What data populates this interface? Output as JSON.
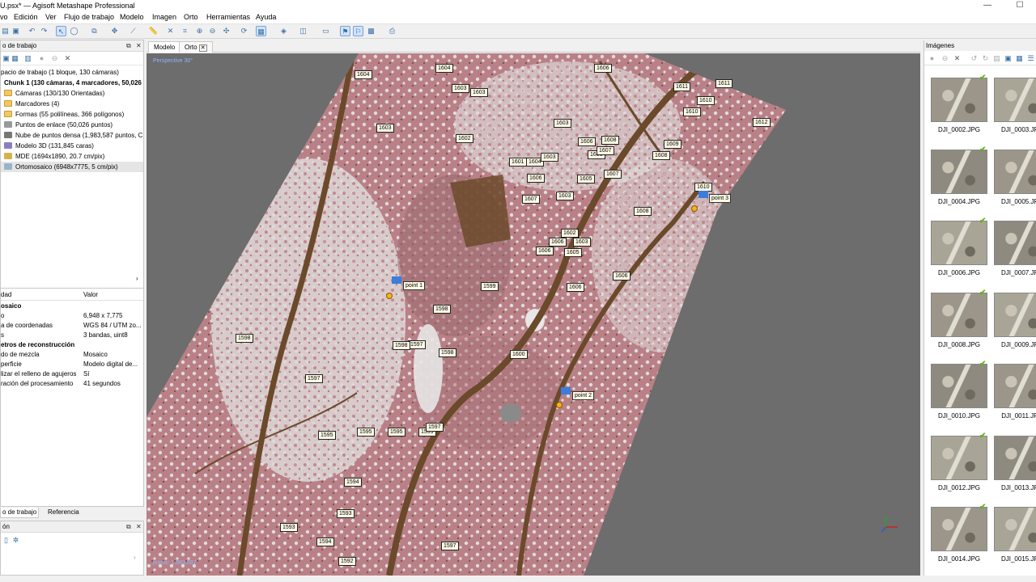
{
  "window": {
    "title": "U.psx* — Agisoft Metashape Professional"
  },
  "menu": [
    "vo",
    "Edición",
    "Ver",
    "Flujo de trabajo",
    "Modelo",
    "Imagen",
    "Orto",
    "Herramientas",
    "Ayuda"
  ],
  "workspace": {
    "header": "o de trabajo",
    "items": [
      "pacio de trabajo (1 bloque, 130 cámaras)",
      "Chunk 1 (130 cámaras, 4 marcadores, 50,026",
      "Cámaras (130/130 Orientadas)",
      "Marcadores (4)",
      "Formas (55 polilíneas, 366 polígonos)",
      "Puntos de enlace (50,026 puntos)",
      "Nube de puntos densa (1,983,587 puntos, C",
      "Modelo 3D (131,845 caras)",
      "MDE (1694x1890, 20.7 cm/pix)",
      "Ortomosaico (6948x7775, 5 cm/pix)"
    ]
  },
  "properties": {
    "col_name": "dad",
    "col_value": "Valor",
    "rows": [
      {
        "name": "osaico",
        "value": "",
        "bold": true
      },
      {
        "name": "o",
        "value": "6,948 x 7,775"
      },
      {
        "name": "a de coordenadas",
        "value": "WGS 84 / UTM zo..."
      },
      {
        "name": "s",
        "value": "3 bandas, uint8"
      },
      {
        "name": "etros de reconstrucción",
        "value": "",
        "bold": true
      },
      {
        "name": "do de mezcla",
        "value": "Mosaico"
      },
      {
        "name": "perficie",
        "value": "Modelo digital de..."
      },
      {
        "name": "lizar el relleno de agujeros",
        "value": "Sí"
      },
      {
        "name": "ración del procesamiento",
        "value": "41 segundos"
      }
    ]
  },
  "left_tabs": {
    "workspace": "o de trabajo",
    "reference": "Referencia"
  },
  "lower_panel": {
    "header": "ón"
  },
  "viewport": {
    "tabs": [
      "Modelo",
      "Orto"
    ],
    "perspective": "Perspective 30°",
    "points_info": "points: 1,983,587",
    "markers": [
      "1604",
      "1604",
      "1603",
      "1603",
      "1606",
      "1611",
      "1611",
      "1610",
      "1610",
      "1612",
      "1603",
      "1602",
      "1603",
      "1601",
      "1604",
      "1603",
      "1606",
      "1606",
      "1607",
      "1608",
      "1609",
      "1608",
      "1606",
      "1605",
      "1607",
      "1607",
      "1603",
      "1610",
      "1608",
      "1602",
      "1606",
      "1606",
      "1603",
      "1605",
      "1606",
      "1606",
      "1599",
      "1598",
      "1598",
      "1597",
      "1598",
      "1600",
      "1598",
      "1597",
      "1595",
      "1595",
      "1595",
      "1599",
      "1597",
      "1594",
      "1593",
      "1593",
      "1594",
      "1597",
      "1592"
    ],
    "points": [
      "point 1",
      "point 2",
      "point 3"
    ]
  },
  "images": {
    "header": "Imágenes",
    "thumbs": [
      "DJI_0002.JPG",
      "DJI_0003.JPG",
      "DJI_0004.JPG",
      "DJI_0005.JPG",
      "DJI_0006.JPG",
      "DJI_0007.JPG",
      "DJI_0008.JPG",
      "DJI_0009.JPG",
      "DJI_0010.JPG",
      "DJI_0011.JPG",
      "DJI_0012.JPG",
      "DJI_0013.JPG",
      "DJI_0014.JPG",
      "DJI_0015.JPG"
    ]
  },
  "colors": {
    "ortho_pink": "#b77a80",
    "ortho_light": "#ddd8d8",
    "path_brown": "#6b4a2b",
    "viewport_bg": "#6d6d6d",
    "check": "#5fb317"
  }
}
